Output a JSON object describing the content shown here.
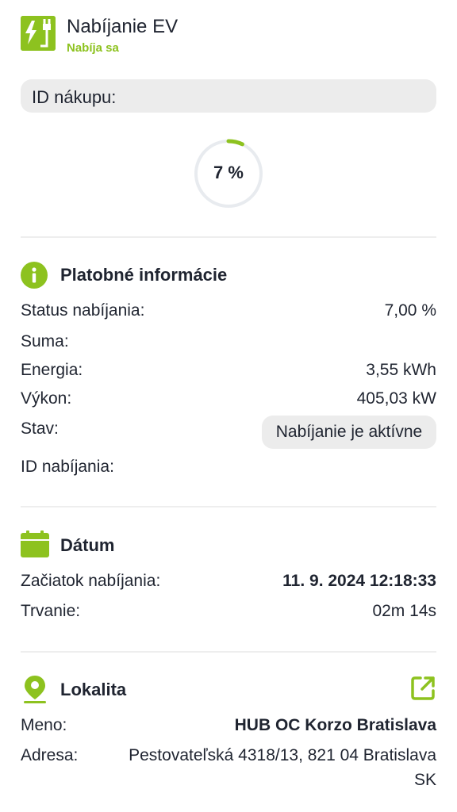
{
  "header": {
    "title": "Nabíjanie EV",
    "status": "Nabíja sa",
    "icon": "ev-charger-icon"
  },
  "purchase_id_label": "ID nákupu:",
  "progress": {
    "percent": 7,
    "label": "7 %",
    "color": "#8dc21f"
  },
  "payment": {
    "title": "Platobné informácie",
    "icon": "info-icon",
    "rows": {
      "status_label": "Status nabíjania:",
      "status_value": "7,00 %",
      "sum_label": "Suma:",
      "energy_label": "Energia:",
      "energy_value": "3,55 kWh",
      "power_label": "Výkon:",
      "power_value": "405,03 kW",
      "state_label": "Stav:",
      "state_value": "Nabíjanie je aktívne",
      "charging_id_label": "ID nabíjania:"
    }
  },
  "date": {
    "title": "Dátum",
    "icon": "calendar-icon",
    "start_label": "Začiatok nabíjania:",
    "start_value": "11. 9. 2024 12:18:33",
    "duration_label": "Trvanie:",
    "duration_value": "02m 14s"
  },
  "location": {
    "title": "Lokalita",
    "icon": "location-pin-icon",
    "external_icon": "external-link-icon",
    "name_label": "Meno:",
    "name_value": "HUB OC Korzo Bratislava",
    "address_label": "Adresa:",
    "address_line1": "Pestovateľská 4318/13, 821 04 Bratislava",
    "address_line2": "SK"
  },
  "colors": {
    "accent": "#8dc21f",
    "text": "#1f2430",
    "pill": "#ececec"
  }
}
